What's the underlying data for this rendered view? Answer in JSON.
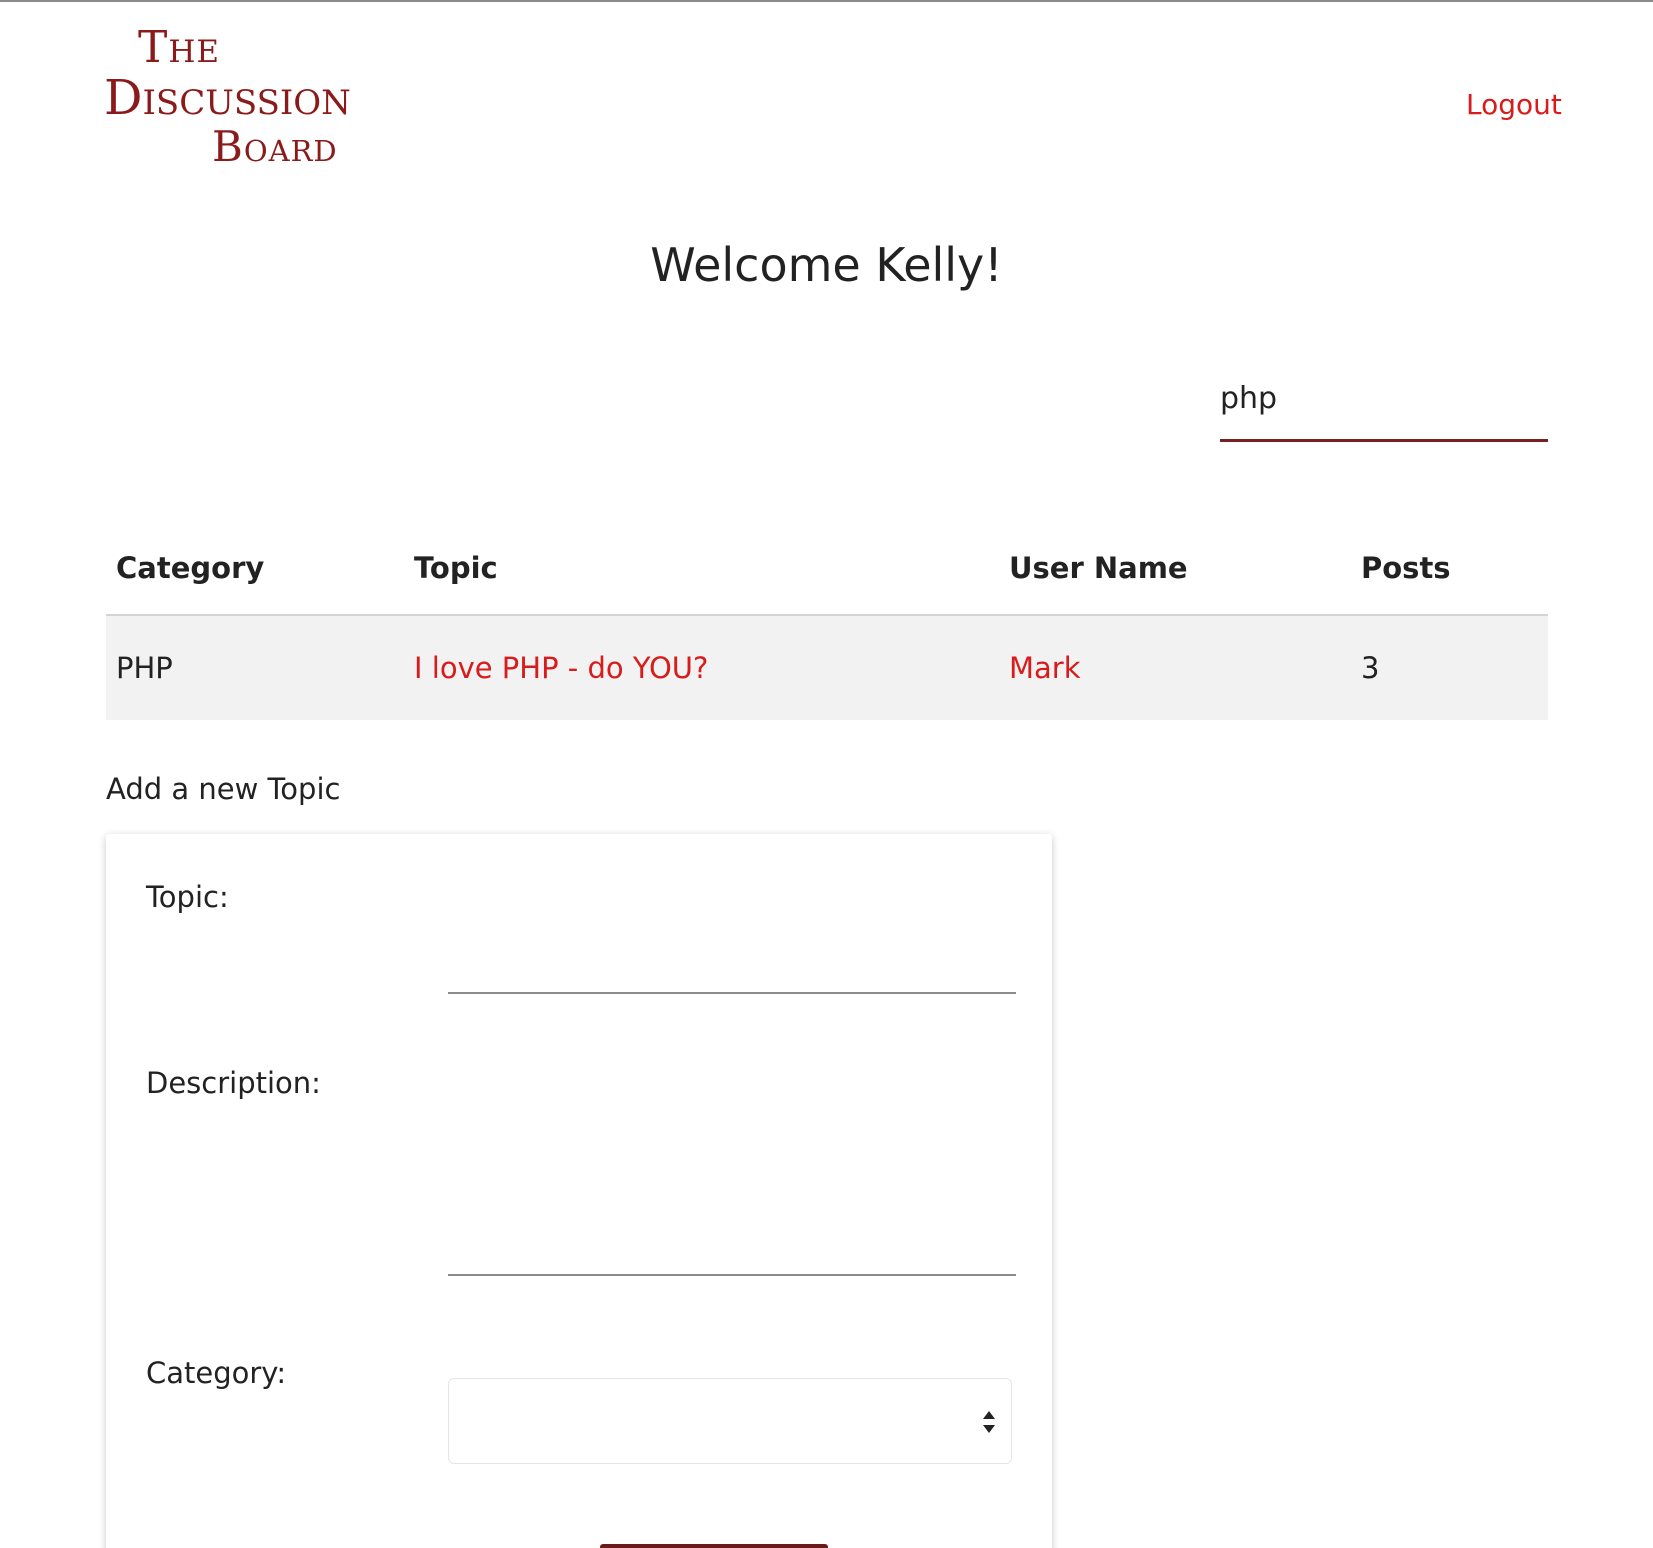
{
  "header": {
    "logo_line1": "The",
    "logo_line2": "Discussion",
    "logo_line3": "Board",
    "logout_label": "Logout"
  },
  "welcome": "Welcome Kelly!",
  "search": {
    "value": "php"
  },
  "table": {
    "headers": [
      "Category",
      "Topic",
      "User Name",
      "Posts"
    ],
    "rows": [
      {
        "category": "PHP",
        "topic": "I love PHP - do YOU?",
        "user": "Mark",
        "posts": "3"
      }
    ]
  },
  "form": {
    "heading": "Add a new Topic",
    "topic_label": "Topic:",
    "topic_value": "",
    "description_label": "Description:",
    "description_value": "",
    "category_label": "Category:",
    "category_value": "",
    "submit_label": ""
  },
  "colors": {
    "brand": "#8b1a1a",
    "link": "#d81b1b",
    "accent_border": "#7a1f1f",
    "row_bg": "#f2f2f2"
  },
  "icons": {
    "select_arrow": "sort-arrows-icon"
  }
}
